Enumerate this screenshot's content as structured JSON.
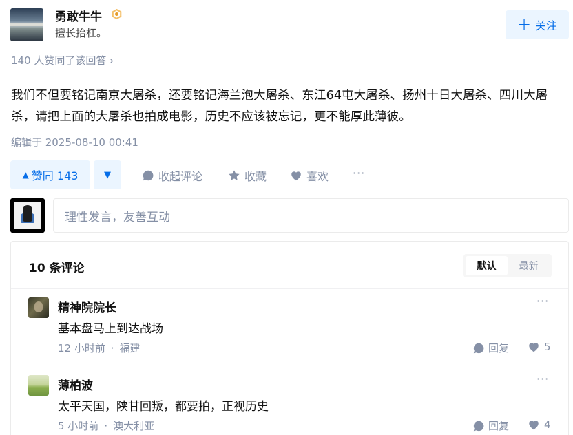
{
  "author": {
    "name": "勇敢牛牛",
    "bio": "擅长抬杠。",
    "follow_label": "关注"
  },
  "vote_summary": "140 人赞同了该回答 ›",
  "answer": {
    "text": "我们不但要铭记南京大屠杀，还要铭记海兰泡大屠杀、东江64屯大屠杀、扬州十日大屠杀、四川大屠杀，请把上面的大屠杀也拍成电影，历史不应该被忘记，更不能厚此薄彼。",
    "edited": "编辑于 2025-08-10 00:41"
  },
  "actions": {
    "upvote_label": "赞同 143",
    "collapse_comments": "收起评论",
    "collect": "收藏",
    "like": "喜欢",
    "more": "···"
  },
  "comment_input": {
    "placeholder": "理性发言，友善互动"
  },
  "comments": {
    "title": "10 条评论",
    "sort_default": "默认",
    "sort_latest": "最新",
    "items": [
      {
        "name": "精神院院长",
        "text": "基本盘马上到达战场",
        "time": "12 小时前",
        "location": "福建",
        "reply_label": "回复",
        "likes": "5"
      },
      {
        "name": "薄柏波",
        "text": "太平天国，陕甘回叛，都要拍，正视历史",
        "time": "5 小时前",
        "location": "澳大利亚",
        "reply_label": "回复",
        "likes": "4"
      }
    ]
  },
  "colors": {
    "brand_blue": "#056de8",
    "light_blue_bg": "#ebf5ff",
    "muted_gray": "#8590a6"
  }
}
